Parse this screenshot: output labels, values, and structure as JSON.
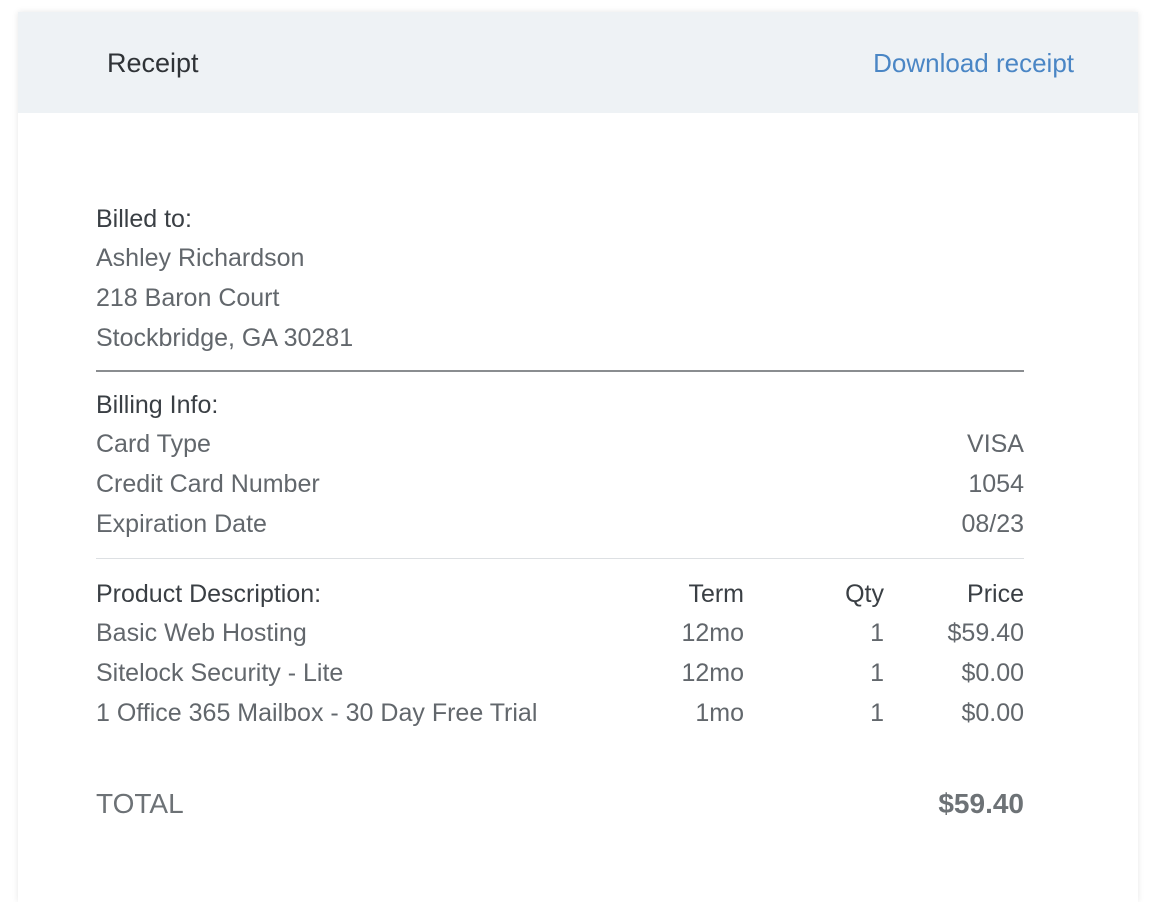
{
  "header": {
    "title": "Receipt",
    "download_label": "Download receipt",
    "link_color": "#4a86c5"
  },
  "billed_to": {
    "heading": "Billed to:",
    "name": "Ashley Richardson",
    "address_line1": "218 Baron Court",
    "address_line2": "Stockbridge, GA 30281"
  },
  "billing_info": {
    "heading": "Billing Info:",
    "rows": [
      {
        "label": "Card Type",
        "value": "VISA"
      },
      {
        "label": "Credit Card Number",
        "value": "1054"
      },
      {
        "label": "Expiration Date",
        "value": "08/23"
      }
    ]
  },
  "products": {
    "headers": {
      "description": "Product Description:",
      "term": "Term",
      "qty": "Qty",
      "price": "Price"
    },
    "rows": [
      {
        "description": "Basic Web Hosting",
        "term": "12mo",
        "qty": "1",
        "price": "$59.40"
      },
      {
        "description": "Sitelock Security - Lite",
        "term": "12mo",
        "qty": "1",
        "price": "$0.00"
      },
      {
        "description": "1 Office 365 Mailbox - 30 Day Free Trial",
        "term": "1mo",
        "qty": "1",
        "price": "$0.00"
      }
    ]
  },
  "total": {
    "label": "TOTAL",
    "value": "$59.40"
  }
}
